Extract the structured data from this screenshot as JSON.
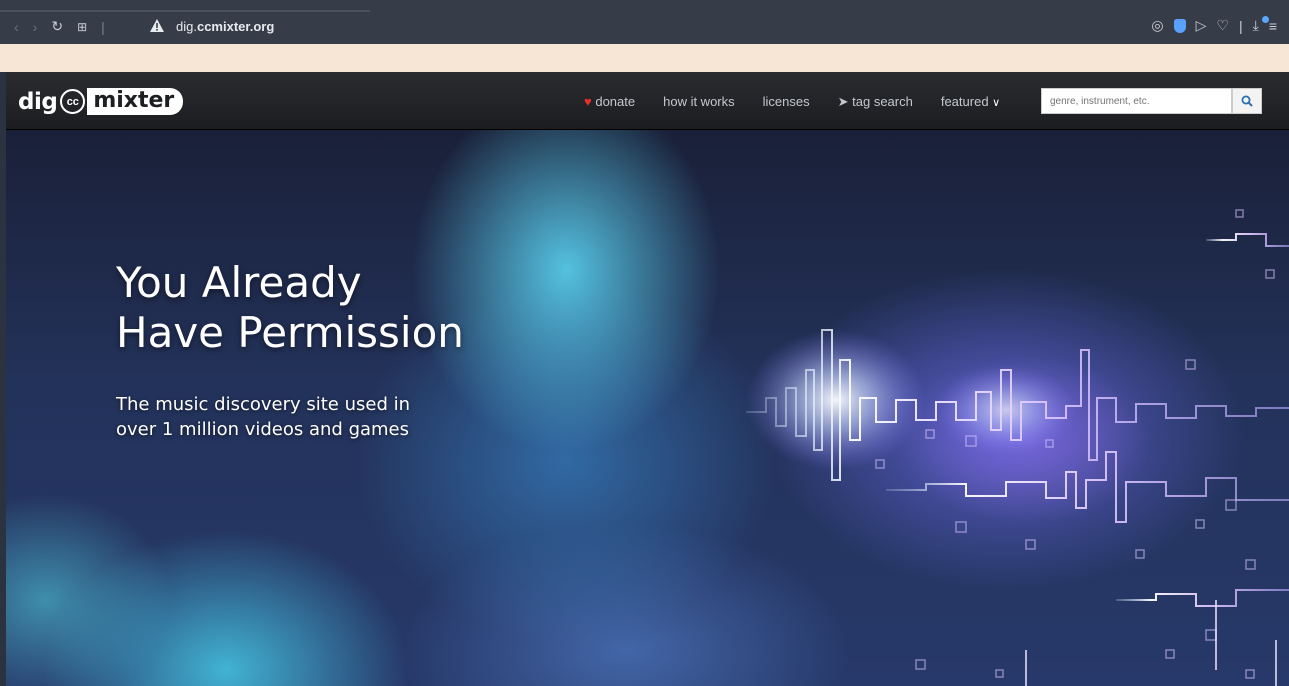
{
  "browser": {
    "url_domain": "dig.",
    "url_bold": "ccmixter.org",
    "icons_left": [
      "back-icon",
      "forward-icon",
      "reload-icon",
      "tab-grid-icon",
      "warning-icon"
    ],
    "icons_right": [
      "camera-icon",
      "shield-icon",
      "send-icon",
      "heart-icon",
      "download-icon",
      "menu-icon"
    ]
  },
  "site": {
    "logo_dig": "dig",
    "logo_cc": "cc",
    "logo_mixter": "mixter",
    "nav": {
      "donate": "donate",
      "how_it_works": "how it works",
      "licenses": "licenses",
      "tag_search": "tag search",
      "featured": "featured"
    },
    "search_placeholder": "genre, instrument, etc."
  },
  "hero": {
    "title_line1": "You Already",
    "title_line2": "Have Permission",
    "subtitle_line1": "The music discovery site used in",
    "subtitle_line2": "over 1 million videos and games"
  },
  "colors": {
    "heart": "#e8302a",
    "nav_bg": "#1f2023",
    "peach_bar": "#f7e6d6",
    "browser_bar": "#373d48"
  }
}
